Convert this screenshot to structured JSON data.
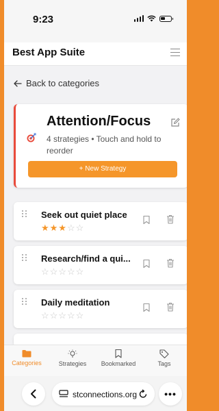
{
  "status_bar": {
    "time": "9:23"
  },
  "header": {
    "title": "Best App Suite"
  },
  "nav": {
    "back_label": "Back to categories"
  },
  "category": {
    "title": "Attention/Focus",
    "subtitle": "4 strategies • Touch and hold to reorder",
    "new_strategy_label": "+ New Strategy",
    "accent_color": "#e94b3c"
  },
  "strategies": [
    {
      "name": "Seek out quiet place",
      "rating": 3,
      "max_rating": 5
    },
    {
      "name": "Research/find a qui...",
      "rating": 0,
      "max_rating": 5
    },
    {
      "name": "Daily meditation",
      "rating": 0,
      "max_rating": 5
    }
  ],
  "tabbar": {
    "items": [
      {
        "label": "Categories",
        "icon": "folder-icon",
        "active": true
      },
      {
        "label": "Strategies",
        "icon": "lightbulb-icon",
        "active": false
      },
      {
        "label": "Bookmarked",
        "icon": "bookmark-icon",
        "active": false
      },
      {
        "label": "Tags",
        "icon": "tag-icon",
        "active": false
      }
    ]
  },
  "browser": {
    "url": "stconnections.org"
  },
  "colors": {
    "brand_orange": "#f5962a",
    "active_tab": "#f08c2a"
  }
}
